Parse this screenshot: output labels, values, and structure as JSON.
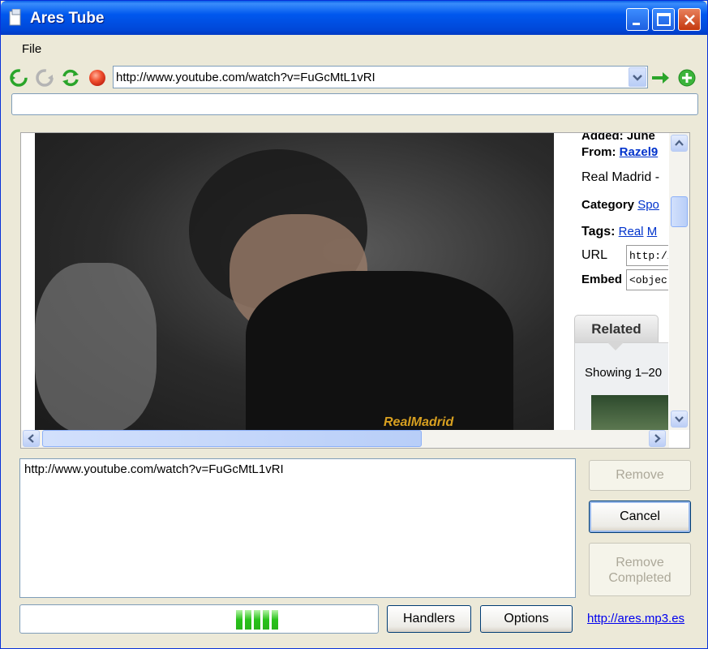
{
  "window": {
    "title": "Ares Tube"
  },
  "menu": {
    "file": "File"
  },
  "toolbar": {
    "url": "http://www.youtube.com/watch?v=FuGcMtL1vRI",
    "icons": [
      "back-icon",
      "forward-icon",
      "refresh-icon",
      "stop-icon",
      "go-arrow-icon",
      "add-download-icon"
    ]
  },
  "status": {
    "text": ""
  },
  "page": {
    "added_label": "Added:",
    "added_value": "June",
    "from_label": "From:",
    "from_value": "Razel9",
    "video_title": "Real Madrid -",
    "category_label": "Category",
    "category_value": "Spo",
    "tags_label": "Tags:",
    "tag_1": "Real",
    "tag_2": "M",
    "url_label": "URL",
    "url_value": "http://w",
    "embed_label": "Embed",
    "embed_value": "<object",
    "related_tab": "Related",
    "showing_text": "Showing 1–20",
    "video_watermark": "RealMadrid"
  },
  "downloads": {
    "items": [
      "http://www.youtube.com/watch?v=FuGcMtL1vRI"
    ]
  },
  "buttons": {
    "remove": "Remove",
    "cancel": "Cancel",
    "remove_completed_1": "Remove",
    "remove_completed_2": "Completed",
    "handlers": "Handlers",
    "options": "Options"
  },
  "footer": {
    "link": "http://ares.mp3.es"
  },
  "colors": {
    "title_bar": "#0058EE",
    "progress": "#28C21A",
    "link": "#0033CC"
  }
}
